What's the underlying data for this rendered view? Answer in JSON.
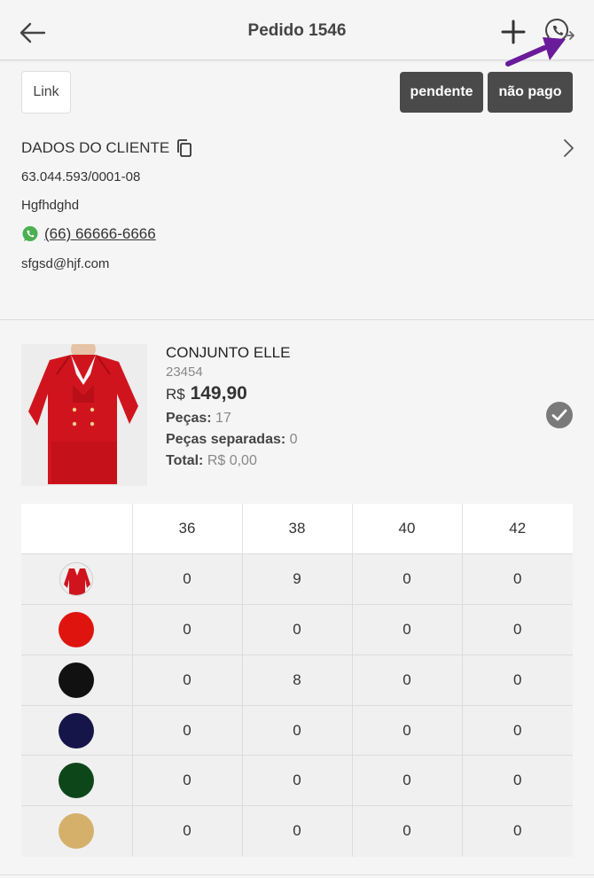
{
  "header": {
    "title": "Pedido 1546",
    "icons": [
      "arrow-left-icon",
      "plus-icon",
      "whatsapp-share-icon"
    ],
    "annotation_color": "#6a1b9a"
  },
  "actions": {
    "link_label": "Link",
    "status_label": "pendente",
    "payment_label": "não pago",
    "status_color": "#4a4a4a"
  },
  "client": {
    "section_title": "DADOS DO CLIENTE",
    "document": "63.044.593/0001-08",
    "name": "Hgfhdghd",
    "phone": "(66) 66666-6666",
    "email": "sfgsd@hjf.com",
    "whatsapp_color": "#4caf50"
  },
  "product": {
    "name": "CONJUNTO ELLE",
    "code": "23454",
    "currency": "R$",
    "price": "149,90",
    "pieces_label": "Peças:",
    "pieces_value": "17",
    "separated_label": "Peças separadas:",
    "separated_value": "0",
    "total_label": "Total:",
    "total_value": "R$ 0,00",
    "main_color": "#d0141e"
  },
  "grid": {
    "sizes": [
      "36",
      "38",
      "40",
      "42"
    ],
    "rows": [
      {
        "variant": "photo",
        "color": "#d0141e",
        "values": [
          "0",
          "9",
          "0",
          "0"
        ]
      },
      {
        "variant": "red",
        "color": "#e0140f",
        "values": [
          "0",
          "0",
          "0",
          "0"
        ]
      },
      {
        "variant": "black",
        "color": "#111111",
        "values": [
          "0",
          "8",
          "0",
          "0"
        ]
      },
      {
        "variant": "navy",
        "color": "#15154a",
        "values": [
          "0",
          "0",
          "0",
          "0"
        ]
      },
      {
        "variant": "green",
        "color": "#0d4719",
        "values": [
          "0",
          "0",
          "0",
          "0"
        ]
      },
      {
        "variant": "beige",
        "color": "#d4b06a",
        "values": [
          "0",
          "0",
          "0",
          "0"
        ]
      }
    ]
  }
}
